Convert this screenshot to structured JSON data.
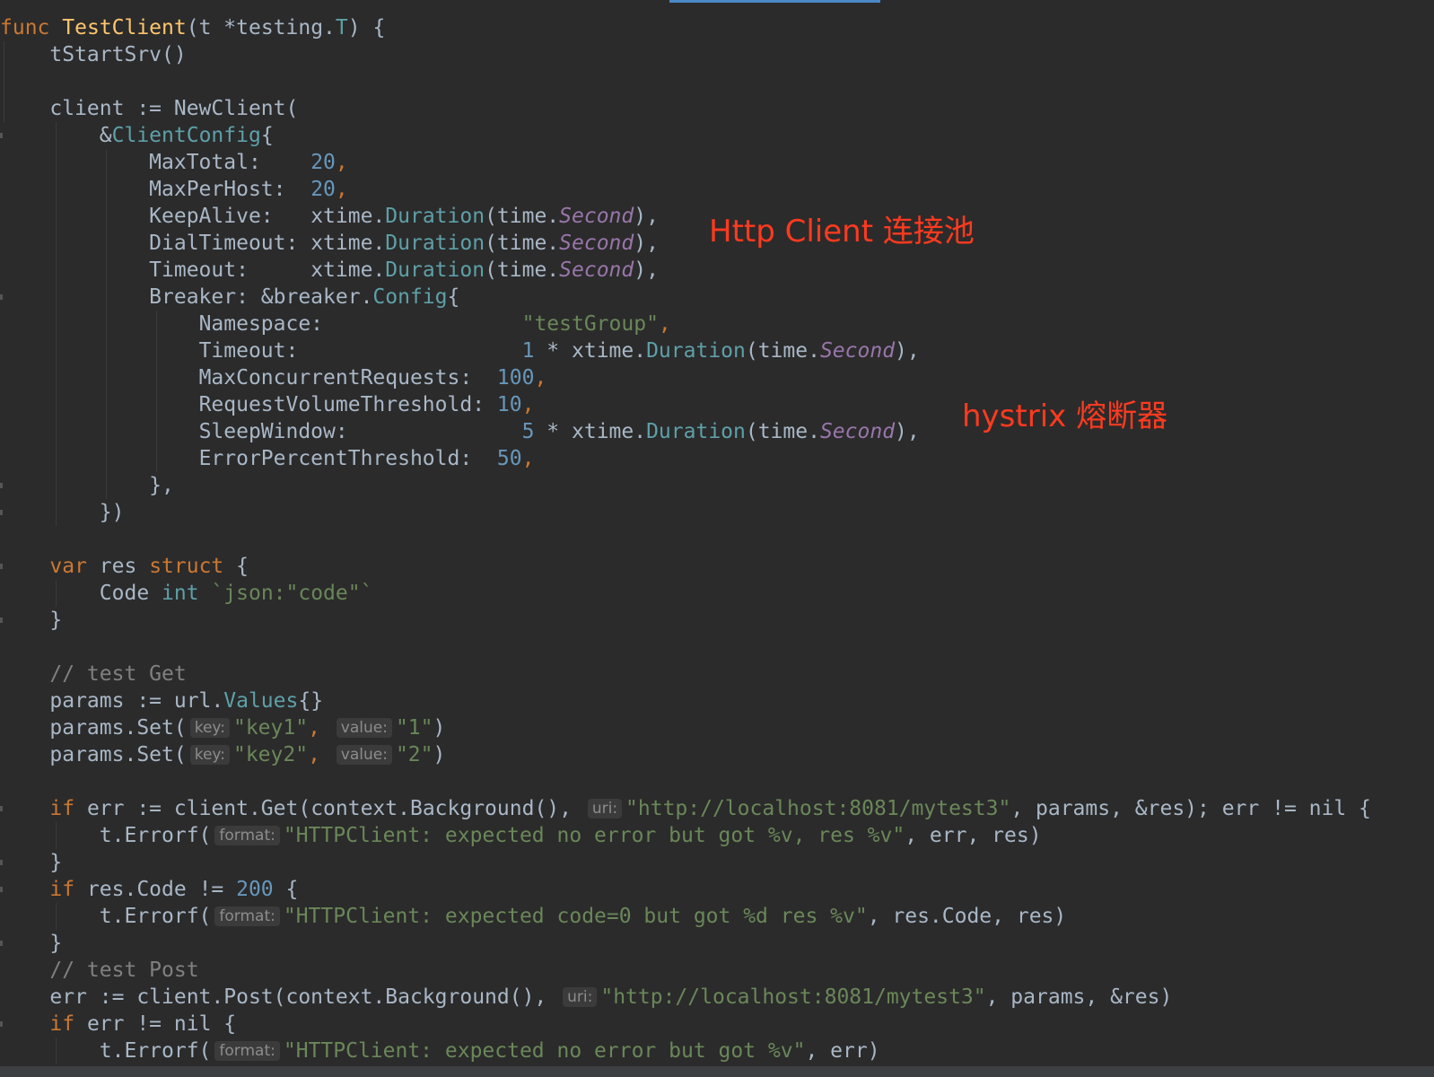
{
  "editor": {
    "language": "go",
    "colors": {
      "background": "#2b2b2b",
      "keyword": "#cc7832",
      "function": "#ffc66d",
      "number": "#6897bb",
      "string": "#6a8759",
      "comment": "#808080",
      "constant": "#9876aa",
      "annotation": "#ff3a1f"
    }
  },
  "code": {
    "l1": {
      "kw": "func",
      "name": "TestClient",
      "sig_a": "(t *testing.",
      "sig_T": "T",
      "sig_b": ") {"
    },
    "l2": {
      "text": "tStartSrv()"
    },
    "l4": {
      "text": "client := NewClient("
    },
    "l5": {
      "amp": "&",
      "type": "ClientConfig",
      "brace": "{"
    },
    "l6": {
      "key": "MaxTotal:    ",
      "value": "20",
      "comma": ","
    },
    "l7": {
      "key": "MaxPerHost:  ",
      "value": "20",
      "comma": ","
    },
    "l8": {
      "key": "KeepAlive:   ",
      "pkg": "xtime.",
      "fn": "Duration",
      "open": "(time.",
      "const": "Second",
      "close": "),"
    },
    "l9": {
      "key": "DialTimeout: ",
      "pkg": "xtime.",
      "fn": "Duration",
      "open": "(time.",
      "const": "Second",
      "close": "),"
    },
    "l10": {
      "key": "Timeout:     ",
      "pkg": "xtime.",
      "fn": "Duration",
      "open": "(time.",
      "const": "Second",
      "close": "),"
    },
    "l11": {
      "key": "Breaker: &breaker.",
      "type": "Config",
      "brace": "{"
    },
    "l12": {
      "key": "Namespace:                ",
      "value": "\"testGroup\"",
      "comma": ","
    },
    "l13": {
      "key": "Timeout:                  ",
      "num": "1",
      "mid": " * xtime.",
      "fn": "Duration",
      "open": "(time.",
      "const": "Second",
      "close": "),"
    },
    "l14": {
      "key": "MaxConcurrentRequests:  ",
      "value": "100",
      "comma": ","
    },
    "l15": {
      "key": "RequestVolumeThreshold: ",
      "value": "10",
      "comma": ","
    },
    "l16": {
      "key": "SleepWindow:              ",
      "num": "5",
      "mid": " * xtime.",
      "fn": "Duration",
      "open": "(time.",
      "const": "Second",
      "close": "),"
    },
    "l17": {
      "key": "ErrorPercentThreshold:  ",
      "value": "50",
      "comma": ","
    },
    "l18": {
      "text": "},"
    },
    "l19": {
      "text": "})"
    },
    "l21": {
      "kw1": "var",
      "mid": " res ",
      "kw2": "struct",
      "end": " {"
    },
    "l22": {
      "field": "Code ",
      "type": "int",
      "tag": " `json:\"code\"`"
    },
    "l23": {
      "text": "}"
    },
    "l25": {
      "text": "// test Get"
    },
    "l26": {
      "a": "params := url.",
      "type": "Values",
      "b": "{}"
    },
    "l27": {
      "call": "params.Set(",
      "hint1": "key:",
      "s1": "\"key1\"",
      "sep": ", ",
      "hint2": "value:",
      "s2": "\"1\"",
      "end": ")"
    },
    "l28": {
      "call": "params.Set(",
      "hint1": "key:",
      "s1": "\"key2\"",
      "sep": ", ",
      "hint2": "value:",
      "s2": "\"2\"",
      "end": ")"
    },
    "l30": {
      "kw": "if",
      "a": " err := client.Get(context.Background(), ",
      "hint": "uri:",
      "s": "\"http://localhost:8081/mytest3\"",
      "b": ", params, &res); err != nil {"
    },
    "l31": {
      "call": "t.Errorf(",
      "hint": "format:",
      "s": "\"HTTPClient: expected no error but got %v, res %v\"",
      "b": ", err, res)"
    },
    "l32": {
      "text": "}"
    },
    "l33": {
      "kw": "if",
      "a": " res.Code != ",
      "num": "200",
      "b": " {"
    },
    "l34": {
      "call": "t.Errorf(",
      "hint": "format:",
      "s": "\"HTTPClient: expected code=0 but got %d res %v\"",
      "b": ", res.Code, res)"
    },
    "l35": {
      "text": "}"
    },
    "l36": {
      "text": "// test Post"
    },
    "l37": {
      "a": "err := client.Post(context.Background(), ",
      "hint": "uri:",
      "s": "\"http://localhost:8081/mytest3\"",
      "b": ", params, &res)"
    },
    "l38": {
      "kw": "if",
      "a": " err != nil {"
    },
    "l39": {
      "call": "t.Errorf(",
      "hint": "format:",
      "s": "\"HTTPClient: expected no error but got %v\"",
      "b": ", err)"
    }
  },
  "annotations": {
    "http_pool": "Http Client 连接池",
    "hystrix": "hystrix 熔断器"
  }
}
